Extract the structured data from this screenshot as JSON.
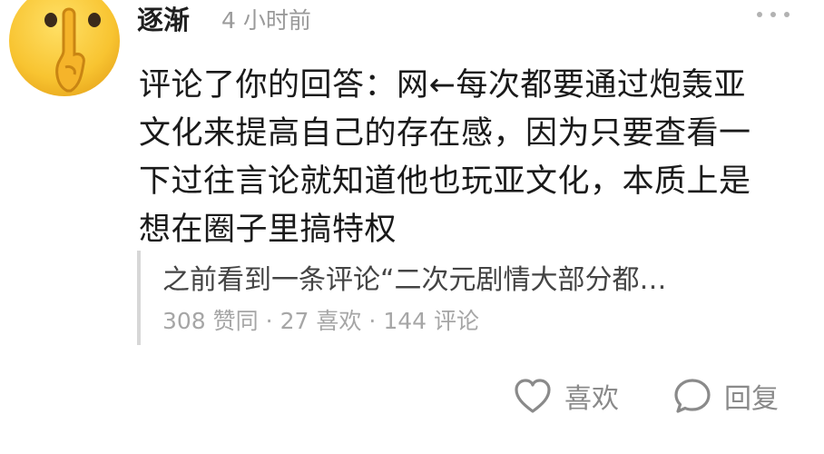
{
  "comment": {
    "username": "逐渐",
    "time": "4 小时前",
    "body": "评论了你的回答：网←每次都要通过炮轰亚文化来提高自己的存在感，因为只要查看一下过往言论就知道他也玩亚文化，本质上是想在圈子里搞特权",
    "quote": {
      "text": "之前看到一条评论“二次元剧情大部分都…",
      "upvotes": "308 赞同",
      "likes": "27 喜欢",
      "comments": "144 评论",
      "separator": "·"
    },
    "actions": {
      "like_label": "喜欢",
      "reply_label": "回复"
    }
  },
  "icons": {
    "avatar": "shushing-face-emoji",
    "more": "more-dots-icon",
    "like": "heart-outline-icon",
    "reply": "speech-bubble-icon"
  },
  "colors": {
    "text": "#1a1a1a",
    "secondary": "#9a9a9a",
    "quote_border": "#d7d7d7",
    "emoji_face": "#f8c431"
  }
}
